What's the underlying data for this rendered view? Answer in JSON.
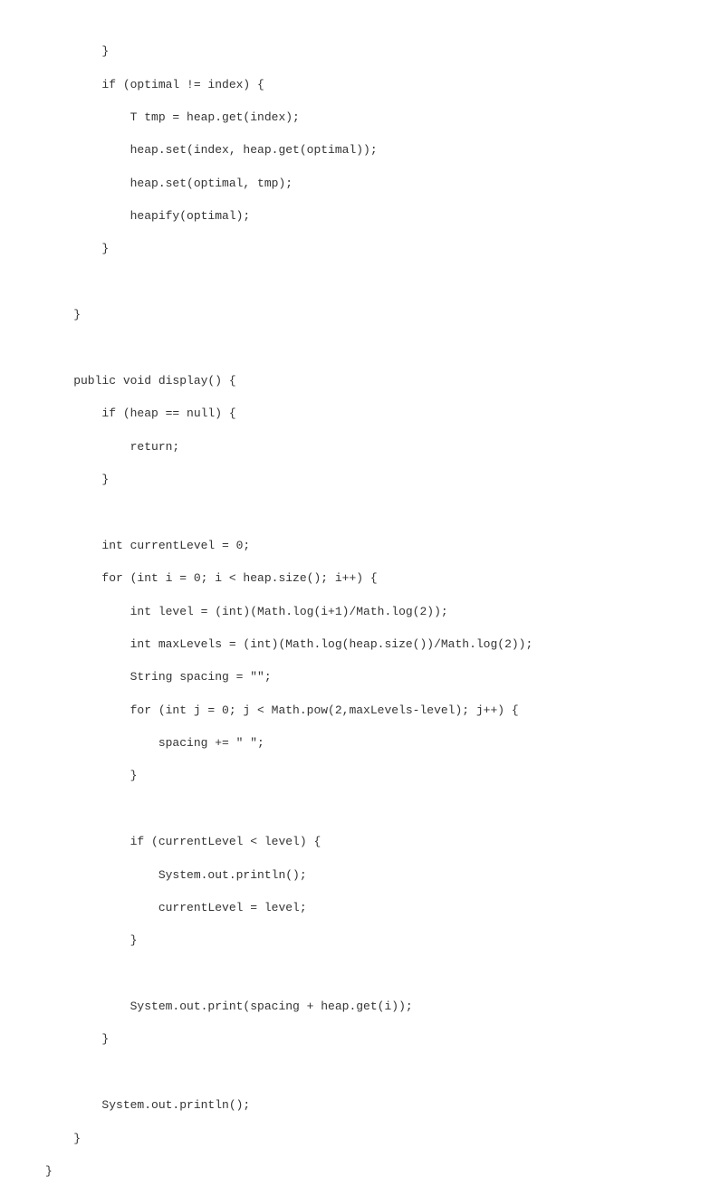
{
  "code": {
    "lines": [
      "        }",
      "        if (optimal != index) {",
      "            T tmp = heap.get(index);",
      "            heap.set(index, heap.get(optimal));",
      "            heap.set(optimal, tmp);",
      "            heapify(optimal);",
      "        }",
      "",
      "    }",
      "",
      "    public void display() {",
      "        if (heap == null) {",
      "            return;",
      "        }",
      "",
      "        int currentLevel = 0;",
      "        for (int i = 0; i < heap.size(); i++) {",
      "            int level = (int)(Math.log(i+1)/Math.log(2));",
      "            int maxLevels = (int)(Math.log(heap.size())/Math.log(2));",
      "            String spacing = \"\";",
      "            for (int j = 0; j < Math.pow(2,maxLevels-level); j++) {",
      "                spacing += \" \";",
      "            }",
      "",
      "            if (currentLevel < level) {",
      "                System.out.println();",
      "                currentLevel = level;",
      "            }",
      "",
      "            System.out.print(spacing + heap.get(i));",
      "        }",
      "",
      "        System.out.println();",
      "    }",
      "}"
    ]
  }
}
